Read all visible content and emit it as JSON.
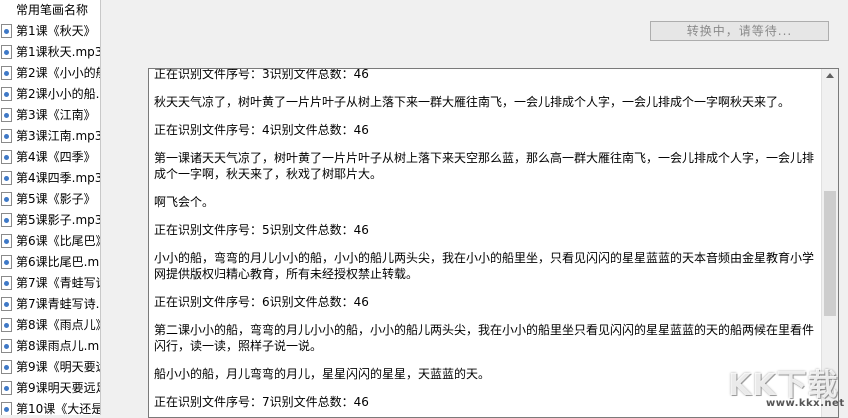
{
  "file_list": {
    "header": "常用笔画名称",
    "items": [
      "第1课《秋天》",
      "第1课秋天.mp3",
      "第2课《小小的船》",
      "第2课小小的船.mp3",
      "第3课《江南》",
      "第3课江南.mp3",
      "第4课《四季》",
      "第4课四季.mp3",
      "第5课《影子》",
      "第5课影子.mp3",
      "第6课《比尾巴》",
      "第6课比尾巴.mp3",
      "第7课《青蛙写诗》",
      "第7课青蛙写诗.mp3",
      "第8课《雨点儿》",
      "第8课雨点儿.mp3",
      "第9课《明天要远足》",
      "第9课明天要远足.mp3",
      "第10课《大还是小》"
    ]
  },
  "status_button": {
    "label": "转换中，请等待..."
  },
  "log": {
    "lines": [
      "正在识别文件序号：3识别文件总数：46",
      "秋天天气凉了，树叶黄了一片片叶子从树上落下来一群大雁往南飞，一会儿排成个人字，一会儿排成个一字啊秋天来了。",
      "正在识别文件序号：4识别文件总数：46",
      "第一课诸天天气凉了，树叶黄了一片片叶子从树上落下来天空那么蓝，那么高一群大雁往南飞，一会儿排成个人字，一会儿排成个一字啊，秋天来了，秋戏了树耶片大。",
      "啊飞会个。",
      "正在识别文件序号：5识别文件总数：46",
      "小小的船，弯弯的月儿小小的船，小小的船儿两头尖，我在小小的船里坐，只看见闪闪的星星蓝蓝的天本音频由金星教育小学网提供版权归精心教育，所有未经授权禁止转载。",
      "正在识别文件序号：6识别文件总数：46",
      "第二课小小的船，弯弯的月儿小小的船，小小的船儿两头尖，我在小小的船里坐只看见闪闪的星星蓝蓝的天的船两候在里看件闪行，读一读，照样子说一说。",
      "船小小的船，月儿弯弯的月儿，星星闪闪的星星，天蓝蓝的天。",
      "正在识别文件序号：7识别文件总数：46"
    ]
  },
  "watermark": {
    "logo": "KK下载",
    "url": "www.kkx.net"
  }
}
